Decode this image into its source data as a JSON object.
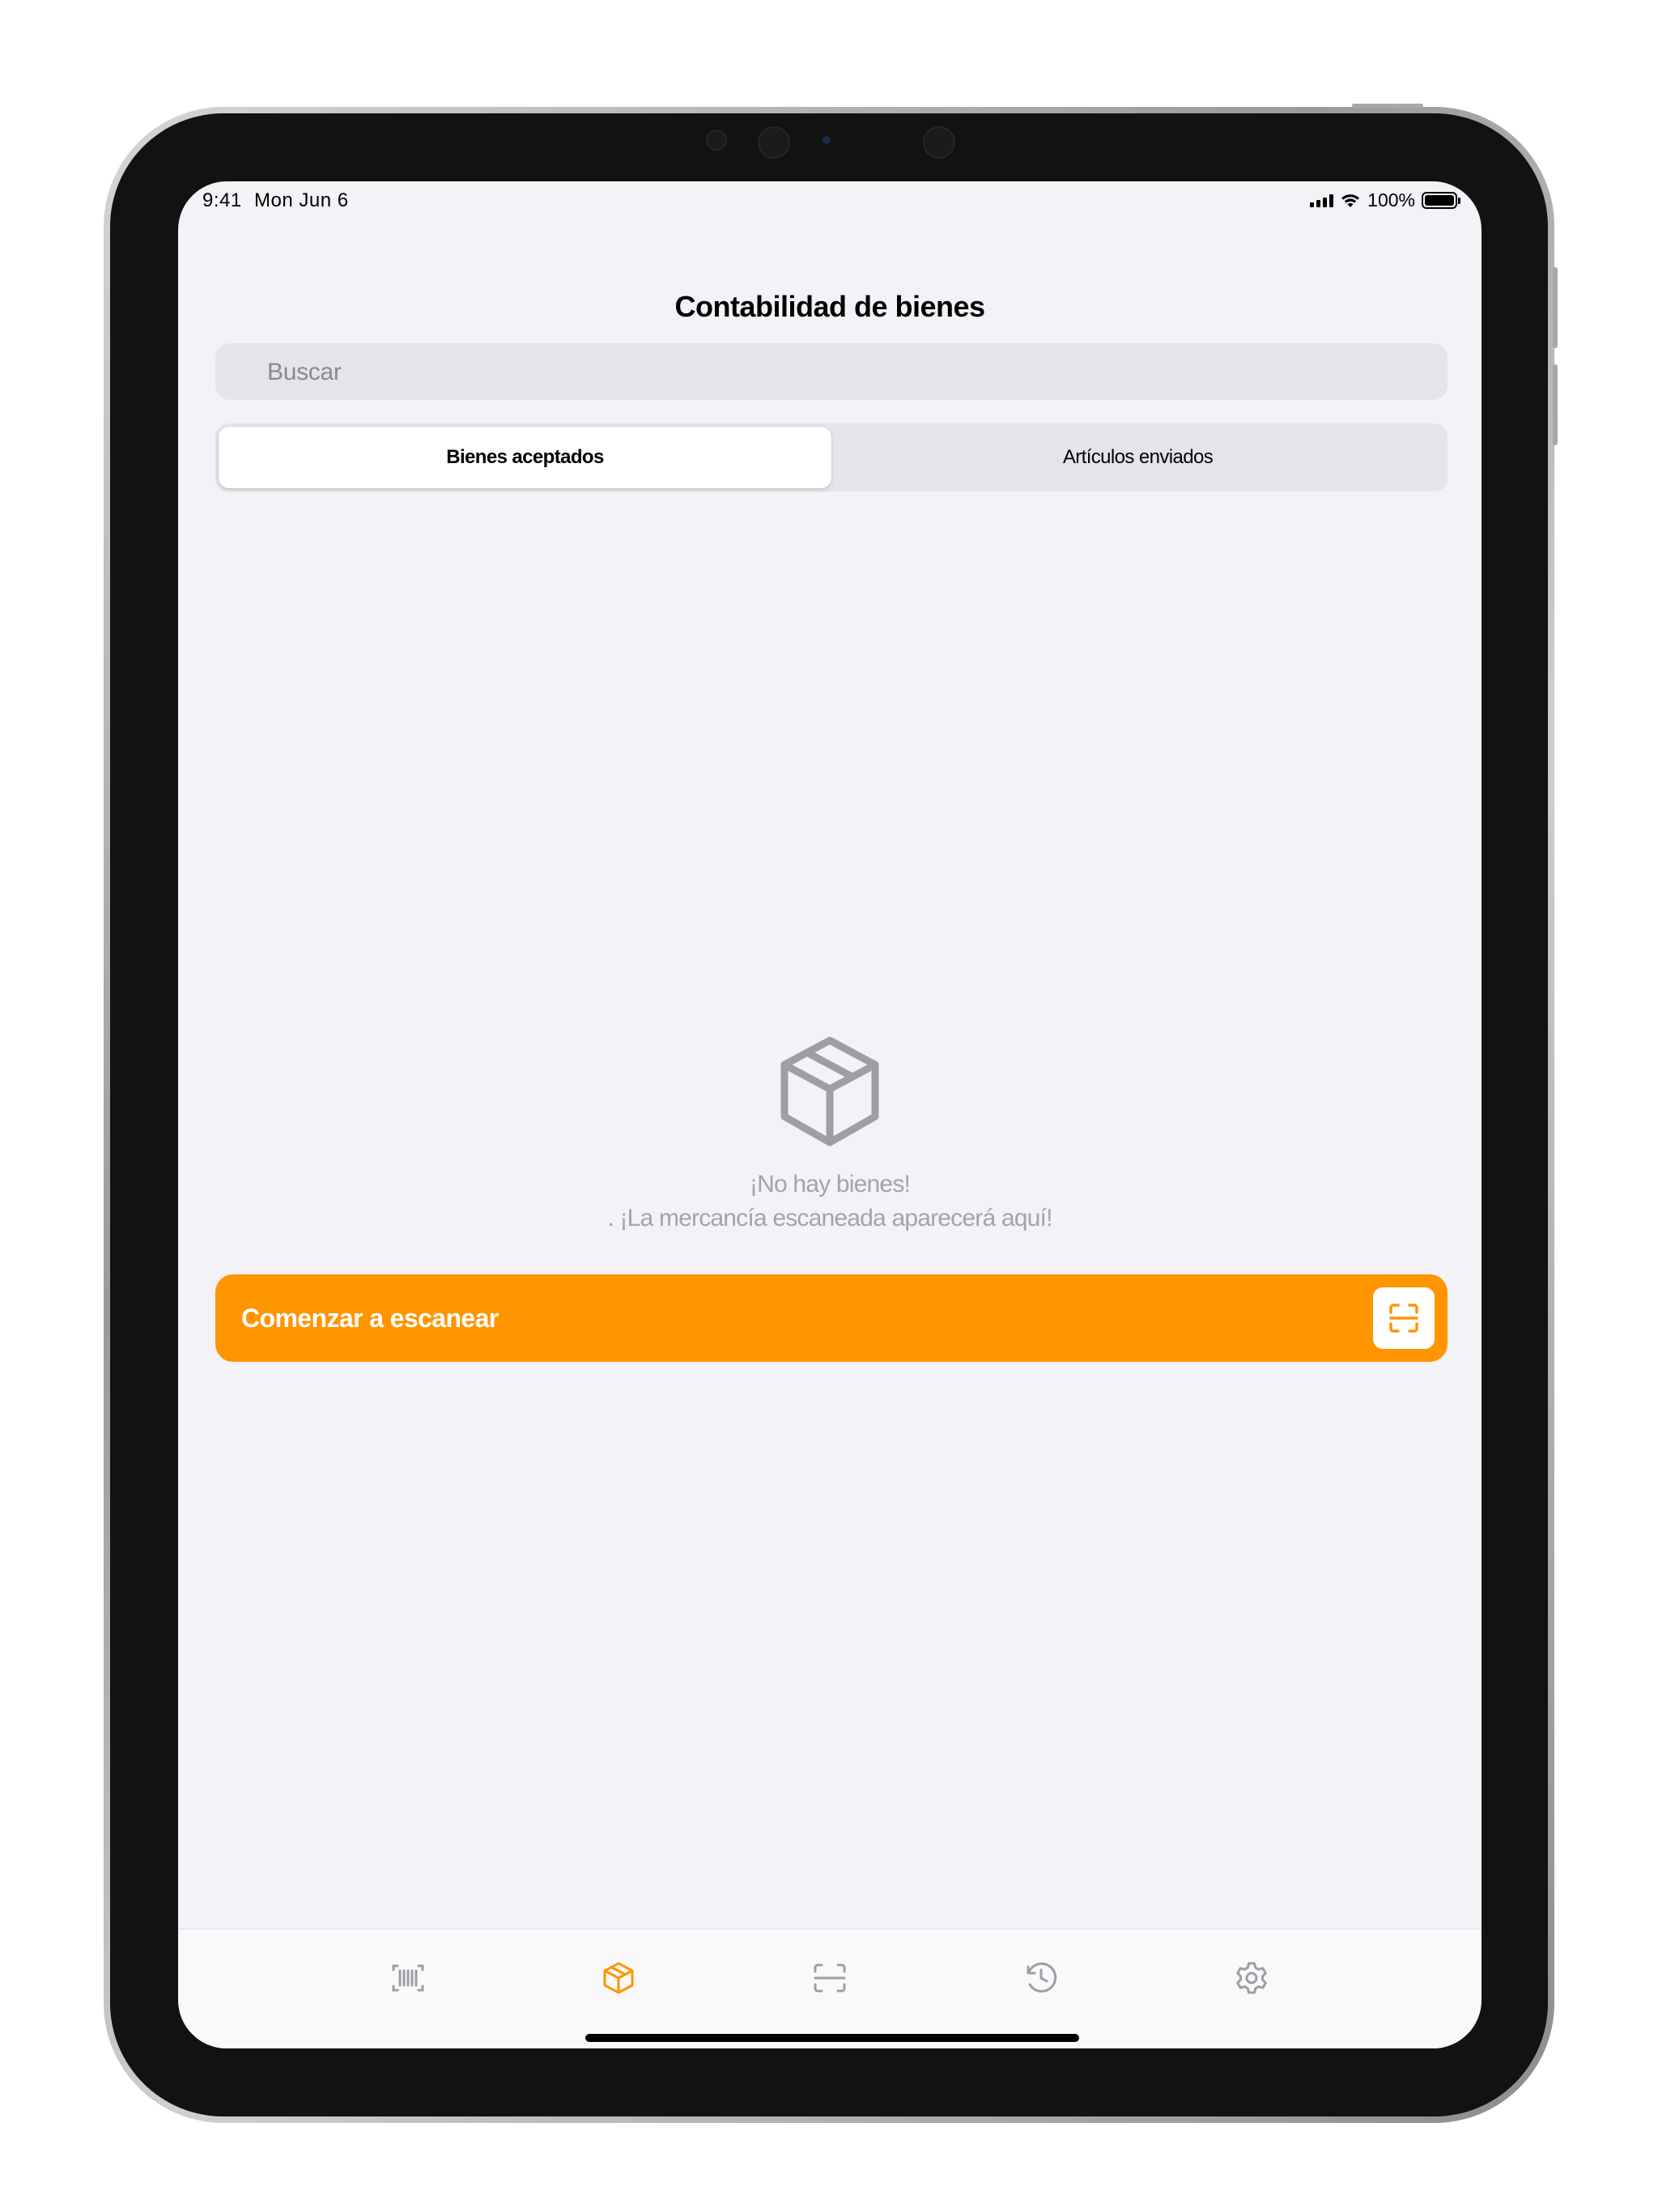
{
  "status_bar": {
    "time": "9:41",
    "date": "Mon Jun 6",
    "battery_percent": "100%",
    "battery_level": 1.0
  },
  "nav": {
    "title": "Contabilidad de bienes"
  },
  "search": {
    "placeholder": "Buscar"
  },
  "segments": [
    {
      "label": "Bienes aceptados",
      "selected": true
    },
    {
      "label": "Artículos enviados",
      "selected": false
    }
  ],
  "empty_state": {
    "icon": "package-box-icon",
    "title": "¡No hay bienes!",
    "subtitle": ". ¡La mercancía escaneada aparecerá aquí!"
  },
  "scan_button": {
    "label": "Comenzar a escanear",
    "icon": "scan-frame-icon"
  },
  "tab_bar": {
    "items": [
      {
        "icon": "barcode-icon",
        "active": false
      },
      {
        "icon": "package-box-icon",
        "active": true
      },
      {
        "icon": "scan-frame-icon",
        "active": false
      },
      {
        "icon": "history-clock-icon",
        "active": false
      },
      {
        "icon": "gear-icon",
        "active": false
      }
    ]
  },
  "colors": {
    "accent": "#FF9500",
    "background": "#F2F2F7",
    "inactive_icon": "#9E9EA3",
    "placeholder_text": "#A3A3A8"
  }
}
